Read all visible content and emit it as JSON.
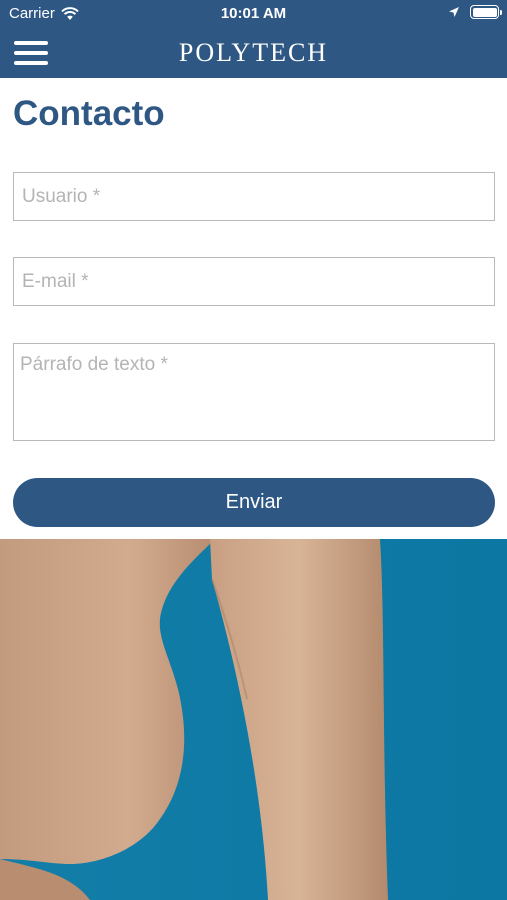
{
  "status": {
    "carrier": "Carrier",
    "time": "10:01 AM"
  },
  "nav": {
    "brand": "POLYTECH"
  },
  "page": {
    "title": "Contacto"
  },
  "form": {
    "user_placeholder": "Usuario *",
    "email_placeholder": "E-mail *",
    "text_placeholder": "Párrafo de texto *",
    "submit_label": "Enviar"
  },
  "colors": {
    "primary": "#2e5883",
    "image_bg": "#0b77a2"
  },
  "icons": [
    "wifi-icon",
    "location-icon",
    "battery-icon",
    "hamburger-menu-icon"
  ]
}
